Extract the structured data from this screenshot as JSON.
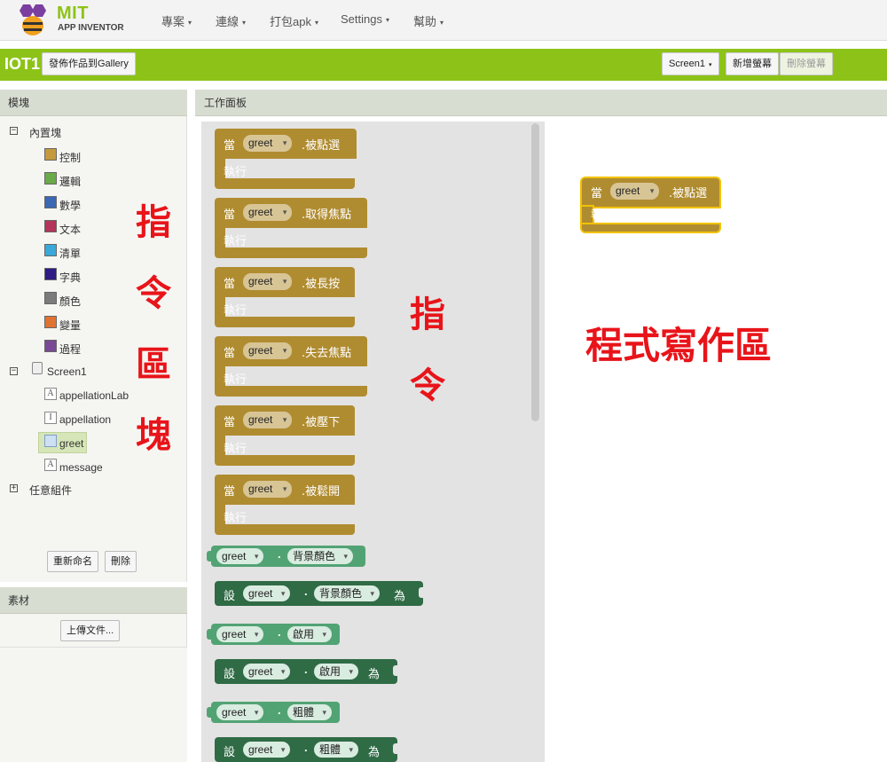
{
  "nav": {
    "logo_mit": "MIT",
    "logo_sub": "APP INVENTOR",
    "menu": [
      "專案",
      "連線",
      "打包apk",
      "Settings",
      "幫助"
    ]
  },
  "toolbar": {
    "project": "IOT1",
    "publish": "發佈作品到Gallery",
    "screen": "Screen1",
    "add_screen": "新增螢幕",
    "remove_screen": "刪除螢幕"
  },
  "blocks_panel": {
    "title": "模塊",
    "builtin": "內置塊",
    "categories": [
      {
        "label": "控制",
        "color": "#c49a3b"
      },
      {
        "label": "邏輯",
        "color": "#6aaa48"
      },
      {
        "label": "數學",
        "color": "#3a68b5"
      },
      {
        "label": "文本",
        "color": "#b4345b"
      },
      {
        "label": "清單",
        "color": "#3aa8d9"
      },
      {
        "label": "字典",
        "color": "#2e1b85"
      },
      {
        "label": "顏色",
        "color": "#7b7b7b"
      },
      {
        "label": "變量",
        "color": "#e07332"
      },
      {
        "label": "過程",
        "color": "#7a4a96"
      }
    ],
    "screen": "Screen1",
    "components": [
      "appellationLab",
      "appellation",
      "greet",
      "message"
    ],
    "any_component": "任意組件",
    "rename_btn": "重新命名",
    "delete_btn": "刪除"
  },
  "assets": {
    "title": "素材",
    "upload_btn": "上傳文件..."
  },
  "workspace": {
    "title": "工作面板",
    "when": "當",
    "do": "執行",
    "component": "greet",
    "events": [
      ".被點選",
      ".取得焦點",
      ".被長按",
      ".失去焦點",
      ".被壓下",
      ".被鬆開"
    ],
    "property_blocks": [
      {
        "kind": "get",
        "prop": "背景顏色"
      },
      {
        "kind": "set",
        "prop": "背景顏色"
      },
      {
        "kind": "get",
        "prop": "啟用"
      },
      {
        "kind": "set",
        "prop": "啟用"
      },
      {
        "kind": "get",
        "prop": "粗體"
      },
      {
        "kind": "set",
        "prop": "粗體"
      }
    ],
    "set_label": "設",
    "to_label": "為",
    "dot": ".",
    "placed_event": ".被點選"
  },
  "annotations": {
    "blocks_area": [
      "指",
      "令",
      "區",
      "塊"
    ],
    "commands": [
      "指",
      "令"
    ],
    "code_area": "程式寫作區"
  },
  "colors": {
    "green_bar": "#8dc318",
    "event_block": "#b08c30",
    "getter_block": "#52a374",
    "setter_block": "#2f6b45",
    "annotation": "#e8141a"
  }
}
